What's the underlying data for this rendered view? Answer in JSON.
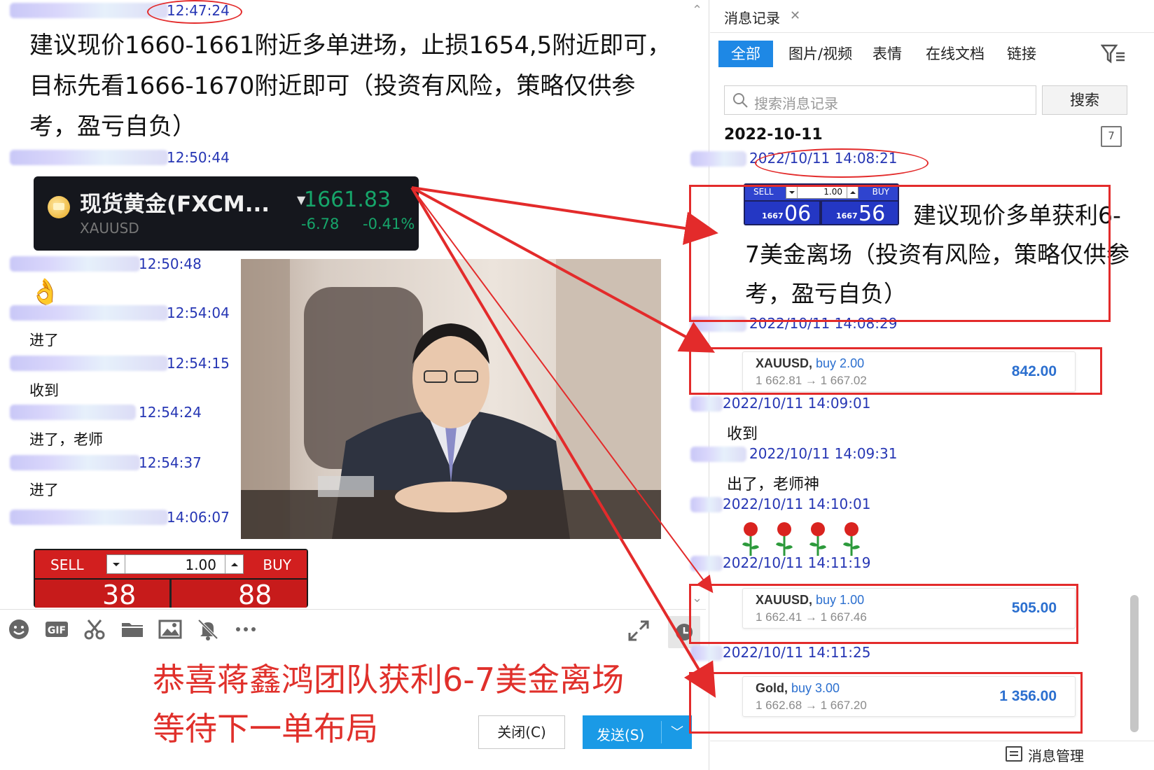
{
  "left_chat": {
    "messages": [
      {
        "time": "12:47:24",
        "text": "建议现价1660-1661附近多单进场，止损1654,5附近即可，目标先看1666-1670附近即可（投资有风险，策略仅供参考，盈亏自负）"
      },
      {
        "time": "12:50:44"
      },
      {
        "time": "12:50:48",
        "emoji": "👌"
      },
      {
        "time": "12:54:04",
        "text": "进了"
      },
      {
        "time": "12:54:15",
        "text": "收到"
      },
      {
        "time": "12:54:24",
        "text": "进了，老师"
      },
      {
        "time": "12:54:37",
        "text": "进了"
      },
      {
        "time": "14:06:07"
      }
    ],
    "gold_card": {
      "name": "现货黄金(FXCM...",
      "symbol": "XAUUSD",
      "price": "1661.83",
      "change": "-6.78",
      "change_pct": "-0.41%"
    },
    "trade_widget": {
      "sell_label": "SELL",
      "buy_label": "BUY",
      "quantity": "1.00",
      "sell_big": "38",
      "buy_big": "88"
    },
    "overlay_caption": "恭喜蒋鑫鸿团队获利6-7美金离场\n等待下一单布局",
    "close_button": "关闭(C)",
    "send_button": "发送(S)"
  },
  "history_panel": {
    "title": "消息记录",
    "tabs": [
      "全部",
      "图片/视频",
      "表情",
      "在线文档",
      "链接"
    ],
    "search_placeholder": "搜索消息记录",
    "search_button": "搜索",
    "date": "2022-10-11",
    "calendar_day": "7",
    "messages": [
      {
        "time": "2022/10/11 14:08:21",
        "text": "建议现价多单获利6-7美金离场（投资有风险，策略仅供参考，盈亏自负）"
      },
      {
        "time": "2022/10/11 14:08:29"
      },
      {
        "time": "2022/10/11 14:09:01",
        "text": "收到"
      },
      {
        "time": "2022/10/11 14:09:31",
        "text": "出了，老师神"
      },
      {
        "time": "2022/10/11 14:10:01"
      },
      {
        "time": "2022/10/11 14:11:19"
      },
      {
        "time": "2022/10/11 14:11:25"
      }
    ],
    "mini_widget": {
      "sell_label": "SELL",
      "buy_label": "BUY",
      "quantity": "1.00",
      "sell_prefix": "1667",
      "sell_big": "06",
      "buy_prefix": "1667",
      "buy_big": "56"
    },
    "trade_cards": [
      {
        "symbol": "XAUUSD,",
        "type": "buy 2.00",
        "prices": "1 662.81 → 1 667.02",
        "profit": "842.00"
      },
      {
        "symbol": "XAUUSD,",
        "type": "buy 1.00",
        "prices": "1 662.41 → 1 667.46",
        "profit": "505.00"
      },
      {
        "symbol": "Gold,",
        "type": "buy 3.00",
        "prices": "1 662.68 → 1 667.20",
        "profit": "1 356.00"
      }
    ],
    "footer_label": "消息管理"
  },
  "colors": {
    "accent_blue": "#1e88e5",
    "timestamp_blue": "#2636b4",
    "annotation_red": "#e32b2b",
    "caption_red": "#e0302b",
    "profit_blue": "#2b6fcf",
    "gold_green": "#16a56a"
  }
}
